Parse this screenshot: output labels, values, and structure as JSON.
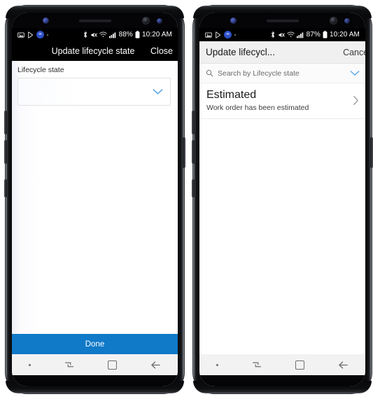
{
  "left_phone": {
    "status_bar": {
      "icons": [
        "image-icon",
        "play-store-icon",
        "app-badge-icon",
        "dot-icon"
      ],
      "bluetooth_icon": "bluetooth-icon",
      "mute_icon": "volume-mute-icon",
      "wifi_icon": "wifi-icon",
      "signal_icon": "signal-bars-icon",
      "battery_percent": "88%",
      "battery_icon": "battery-icon",
      "time": "10:20 AM"
    },
    "app_bar": {
      "title": "Update lifecycle state",
      "action_label": "Close"
    },
    "form": {
      "field_label": "Lifecycle state",
      "field_value": "",
      "chevron_icon": "chevron-down-icon"
    },
    "primary_button": {
      "label": "Done",
      "color": "#1079c8"
    },
    "nav_bar": {
      "dot_icon": "dot-icon",
      "recents_icon": "recents-icon",
      "home_icon": "home-square-icon",
      "back_icon": "back-arrow-icon"
    }
  },
  "right_phone": {
    "status_bar": {
      "icons": [
        "image-icon",
        "play-store-icon",
        "app-badge-icon",
        "dot-icon"
      ],
      "bluetooth_icon": "bluetooth-icon",
      "mute_icon": "volume-mute-icon",
      "wifi_icon": "wifi-icon",
      "signal_icon": "signal-bars-icon",
      "battery_percent": "87%",
      "battery_icon": "battery-icon",
      "time": "10:20 AM"
    },
    "app_bar": {
      "title": "Update lifecycl...",
      "action_label": "Cancel"
    },
    "search": {
      "search_icon": "search-icon",
      "placeholder": "Search by Lifecycle state",
      "value": "",
      "chevron_icon": "chevron-down-icon"
    },
    "list": [
      {
        "primary": "Estimated",
        "secondary": "Work order has been estimated",
        "chevron_icon": "chevron-right-icon"
      }
    ],
    "nav_bar": {
      "dot_icon": "dot-icon",
      "recents_icon": "recents-icon",
      "home_icon": "home-square-icon",
      "back_icon": "back-arrow-icon"
    }
  },
  "theme": {
    "accent_blue": "#1079c8",
    "chevron_blue": "#5ea8e5",
    "status_bar_bg": "#000000",
    "nav_bar_bg": "#f2f2f2"
  }
}
